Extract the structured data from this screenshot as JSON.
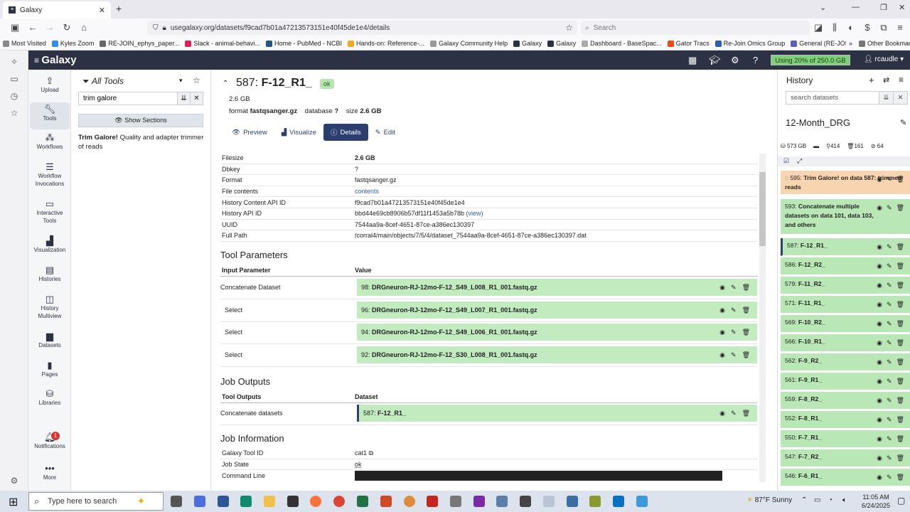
{
  "browser": {
    "tab_title": "Galaxy",
    "url": "usegalaxy.org/datasets/f9cad7b01a47213573151e40f45de1e4/details",
    "search_placeholder": "Search",
    "bookmarks": [
      "Most Visited",
      "Kyles Zoom",
      "RE-JOIN_ephys_paper...",
      "Slack - animal-behavi...",
      "Home - PubMed - NCBI",
      "Hands-on: Reference-...",
      "Galaxy Community Help",
      "Galaxy",
      "Galaxy",
      "Dashboard - BaseSpac...",
      "Gator Tracs",
      "Re-Join Omics Group",
      "General (RE-JOIN Con..."
    ],
    "other_bookmarks": "Other Bookmarks"
  },
  "masthead": {
    "logo": "Galaxy",
    "quota": "Using 20% of 250.0 GB",
    "user": "rcaudle"
  },
  "activity": {
    "items": [
      "Upload",
      "Tools",
      "Workflows",
      "Workflow Invocations",
      "Interactive Tools",
      "Visualization",
      "Histories",
      "History Multiview",
      "Datasets",
      "Pages",
      "Libraries",
      "Notifications",
      "More"
    ],
    "notification_count": "1"
  },
  "tool_panel": {
    "title": "All Tools",
    "search_value": "trim galore",
    "show_sections": "Show Sections",
    "result_name": "Trim Galore!",
    "result_desc": "Quality and adapter trimmer of reads"
  },
  "dataset": {
    "hid": "587:",
    "name": "F-12_R1_",
    "state": "ok",
    "size_line": "2.6 GB",
    "format_label": "format",
    "format_value": "fastqsanger.gz",
    "database_label": "database",
    "database_value": "?",
    "size_label": "size",
    "size_value": "2.6 GB",
    "tabs": [
      "Preview",
      "Visualize",
      "Details",
      "Edit"
    ]
  },
  "details": [
    {
      "k": "Filesize",
      "v": "2.6 GB"
    },
    {
      "k": "Dbkey",
      "v": "?"
    },
    {
      "k": "Format",
      "v": "fastqsanger.gz"
    },
    {
      "k": "File contents",
      "v": "contents"
    },
    {
      "k": "History Content API ID",
      "v": "f9cad7b01a47213573151e40f45de1e4"
    },
    {
      "k": "History API ID",
      "v": "bbd44e69cb8906b57df11f1453a5b78b"
    },
    {
      "k": "UUID",
      "v": "7544aa9a-8cef-4651-87ce-a386ec130397"
    },
    {
      "k": "Full Path",
      "v": "/corral4/main/objects/7/5/4/dataset_7544aa9a-8cef-4651-87ce-a386ec130397.dat"
    }
  ],
  "history_api_view": "(view)",
  "tool_parameters": {
    "title": "Tool Parameters",
    "col1": "Input Parameter",
    "col2": "Value",
    "rows": [
      {
        "k": "Concatenate Dataset",
        "hid": "98:",
        "name": "DRGneuron-RJ-12mo-F-12_S49_L008_R1_001.fastq.gz"
      },
      {
        "k": "Select",
        "hid": "96:",
        "name": "DRGneuron-RJ-12mo-F-12_S49_L007_R1_001.fastq.gz"
      },
      {
        "k": "Select",
        "hid": "94:",
        "name": "DRGneuron-RJ-12mo-F-12_S49_L006_R1_001.fastq.gz"
      },
      {
        "k": "Select",
        "hid": "92:",
        "name": "DRGneuron-RJ-12mo-F-12_S30_L008_R1_001.fastq.gz"
      }
    ]
  },
  "job_outputs": {
    "title": "Job Outputs",
    "col1": "Tool Outputs",
    "col2": "Dataset",
    "row": {
      "k": "Concatenate datasets",
      "hid": "587:",
      "name": "F-12_R1_"
    }
  },
  "job_info": {
    "title": "Job Information",
    "rows": [
      {
        "k": "Galaxy Tool ID",
        "v": "cat1"
      },
      {
        "k": "Job State",
        "v": "ok"
      },
      {
        "k": "Command Line",
        "v": ""
      }
    ]
  },
  "history": {
    "title": "History",
    "search_placeholder": "search datasets",
    "name": "12-Month_DRG",
    "size": "573 GB",
    "count_ok": "414",
    "count_deleted": "161",
    "count_hidden": "64",
    "items": [
      {
        "hid": "595:",
        "name": "Trim Galore! on data 587: trimmed reads",
        "state": "running"
      },
      {
        "hid": "593:",
        "name": "Concatenate multiple datasets on data 101, data 103, and others",
        "state": "ok"
      },
      {
        "hid": "587:",
        "name": "F-12_R1_",
        "state": "ok"
      },
      {
        "hid": "586:",
        "name": "F-12_R2_",
        "state": "ok"
      },
      {
        "hid": "579:",
        "name": "F-11_R2_",
        "state": "ok"
      },
      {
        "hid": "571:",
        "name": "F-11_R1_",
        "state": "ok"
      },
      {
        "hid": "569:",
        "name": "F-10_R2_",
        "state": "ok"
      },
      {
        "hid": "566:",
        "name": "F-10_R1_",
        "state": "ok"
      },
      {
        "hid": "562:",
        "name": "F-9_R2_",
        "state": "ok"
      },
      {
        "hid": "561:",
        "name": "F-9_R1_",
        "state": "ok"
      },
      {
        "hid": "559:",
        "name": "F-8_R2_",
        "state": "ok"
      },
      {
        "hid": "552:",
        "name": "F-8_R1_",
        "state": "ok"
      },
      {
        "hid": "550:",
        "name": "F-7_R1_",
        "state": "ok"
      },
      {
        "hid": "547:",
        "name": "F-7_R2_",
        "state": "ok"
      },
      {
        "hid": "546:",
        "name": "F-6_R1_",
        "state": "ok"
      }
    ]
  },
  "taskbar": {
    "search_placeholder": "Type here to search",
    "weather": "87°F  Sunny",
    "time": "11:05 AM",
    "date": "6/24/2025"
  },
  "colors": {
    "masthead": "#2c3143",
    "ok": "#b9e7b6",
    "running": "#f9d4b0",
    "accent": "#2c3e6e"
  }
}
